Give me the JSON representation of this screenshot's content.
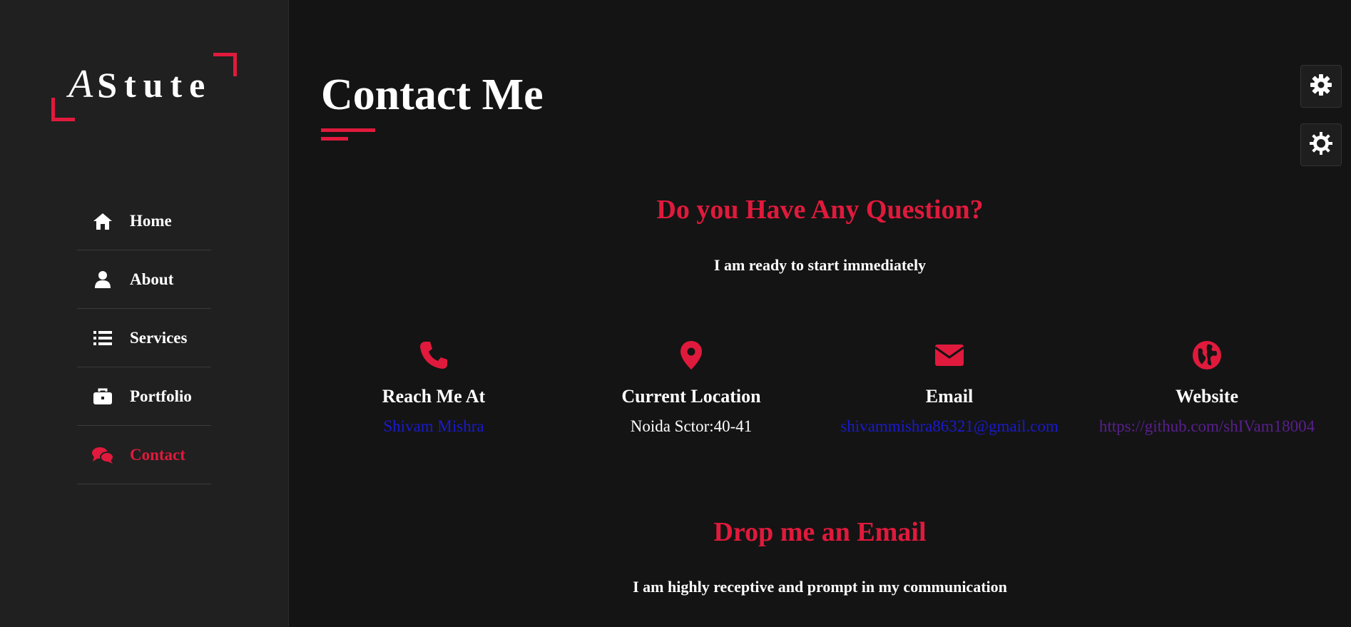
{
  "brand": {
    "logo_letter": "A",
    "logo_rest": "Stute",
    "accent": "#e01a3c"
  },
  "sidebar": {
    "items": [
      {
        "label": "Home",
        "icon": "home-icon",
        "active": false
      },
      {
        "label": "About",
        "icon": "user-icon",
        "active": false
      },
      {
        "label": "Services",
        "icon": "list-icon",
        "active": false
      },
      {
        "label": "Portfolio",
        "icon": "briefcase-icon",
        "active": false
      },
      {
        "label": "Contact",
        "icon": "comments-icon",
        "active": true
      }
    ]
  },
  "main": {
    "title": "Contact Me",
    "question_heading": "Do you Have Any Question?",
    "question_sub": "I am ready to start immediately",
    "cards": [
      {
        "icon": "phone-icon",
        "title": "Reach Me At",
        "value": "Shivam Mishra"
      },
      {
        "icon": "map-pin-icon",
        "title": "Current Location",
        "value": "Noida Sctor:40-41"
      },
      {
        "icon": "envelope-icon",
        "title": "Email",
        "value": "shivammishra86321@gmail.com"
      },
      {
        "icon": "globe-icon",
        "title": "Website",
        "value": "https://github.com/shIVam18004"
      }
    ],
    "email_heading": "Drop me an Email",
    "email_sub": "I am highly receptive and prompt in my communication"
  },
  "settings": {
    "buttons": [
      "gear-icon",
      "sun-gear-icon"
    ]
  }
}
